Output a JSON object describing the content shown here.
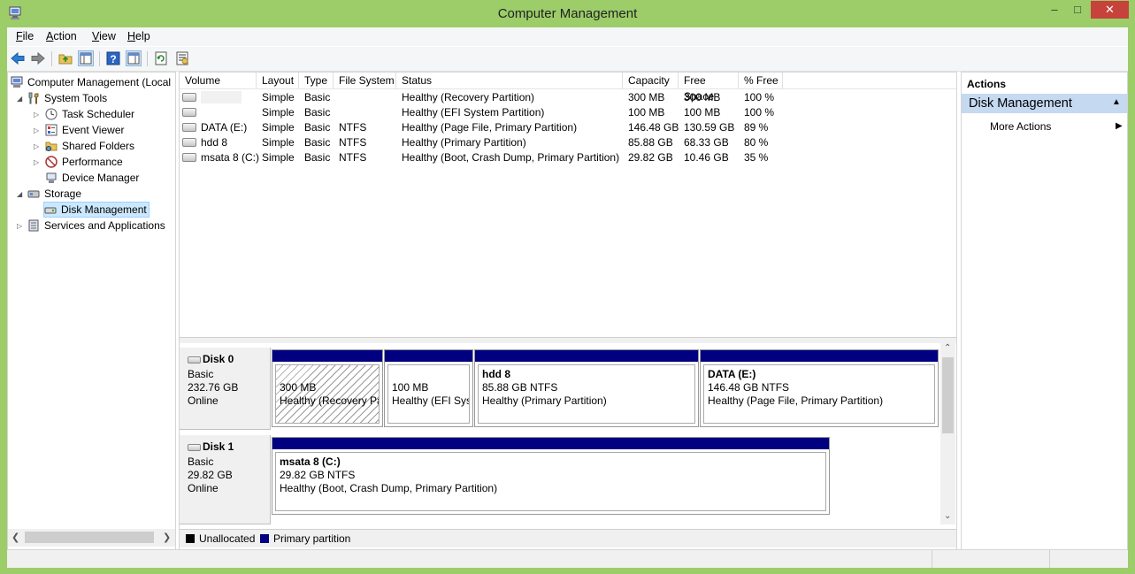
{
  "window": {
    "title": "Computer Management",
    "minimize_glyph": "–",
    "maximize_glyph": "□",
    "close_glyph": "✕",
    "close_color": "#c7423a"
  },
  "menu": [
    {
      "underline": "F",
      "rest": "ile"
    },
    {
      "underline": "A",
      "rest": "ction"
    },
    {
      "underline": "V",
      "rest": "iew"
    },
    {
      "underline": "H",
      "rest": "elp"
    }
  ],
  "toolbar": {
    "icons": [
      "back-icon",
      "forward-icon",
      "up-folder-icon",
      "show-hide-tree-icon",
      "help-icon",
      "show-hide-action-pane-icon",
      "refresh-icon",
      "properties-icon"
    ]
  },
  "tree": {
    "root": "Computer Management (Local",
    "system_tools": "System Tools",
    "task_scheduler": "Task Scheduler",
    "event_viewer": "Event Viewer",
    "shared_folders": "Shared Folders",
    "performance": "Performance",
    "device_manager": "Device Manager",
    "storage": "Storage",
    "disk_management": "Disk Management",
    "services": "Services and Applications",
    "expand_glyph": "▷",
    "collapse_glyph": "◢"
  },
  "volumes": {
    "columns": [
      "Volume",
      "Layout",
      "Type",
      "File System",
      "Status",
      "Capacity",
      "Free Space",
      "% Free"
    ],
    "rows": [
      {
        "volume": "",
        "layout": "Simple",
        "type": "Basic",
        "fs": "",
        "status": "Healthy (Recovery Partition)",
        "capacity": "300 MB",
        "free": "300 MB",
        "pct": "100 %"
      },
      {
        "volume": "",
        "layout": "Simple",
        "type": "Basic",
        "fs": "",
        "status": "Healthy (EFI System Partition)",
        "capacity": "100 MB",
        "free": "100 MB",
        "pct": "100 %"
      },
      {
        "volume": "DATA (E:)",
        "layout": "Simple",
        "type": "Basic",
        "fs": "NTFS",
        "status": "Healthy (Page File, Primary Partition)",
        "capacity": "146.48 GB",
        "free": "130.59 GB",
        "pct": "89 %"
      },
      {
        "volume": "hdd 8",
        "layout": "Simple",
        "type": "Basic",
        "fs": "NTFS",
        "status": "Healthy (Primary Partition)",
        "capacity": "85.88 GB",
        "free": "68.33 GB",
        "pct": "80 %"
      },
      {
        "volume": "msata 8 (C:)",
        "layout": "Simple",
        "type": "Basic",
        "fs": "NTFS",
        "status": "Healthy (Boot, Crash Dump, Primary Partition)",
        "capacity": "29.82 GB",
        "free": "10.46 GB",
        "pct": "35 %"
      }
    ]
  },
  "disks": {
    "disk0": {
      "name": "Disk 0",
      "kind": "Basic",
      "size": "232.76 GB",
      "state": "Online",
      "partitions": [
        {
          "name": "",
          "size": "300 MB",
          "status": "Healthy (Recovery Pa"
        },
        {
          "name": "",
          "size": "100 MB",
          "status": "Healthy (EFI Syst"
        },
        {
          "name": "hdd 8",
          "size": "85.88 GB NTFS",
          "status": "Healthy (Primary Partition)"
        },
        {
          "name": "DATA  (E:)",
          "size": "146.48 GB NTFS",
          "status": "Healthy (Page File, Primary Partition)"
        }
      ]
    },
    "disk1": {
      "name": "Disk 1",
      "kind": "Basic",
      "size": "29.82 GB",
      "state": "Online",
      "partitions": [
        {
          "name": "msata 8  (C:)",
          "size": "29.82 GB NTFS",
          "status": "Healthy (Boot, Crash Dump, Primary Partition)"
        }
      ]
    }
  },
  "legend": {
    "unallocated": "Unallocated",
    "primary": "Primary partition",
    "unallocated_color": "#000000",
    "primary_color": "#000080"
  },
  "actions": {
    "header": "Actions",
    "section": "Disk Management",
    "more": "More Actions",
    "section_color": "#c5d9f1"
  }
}
